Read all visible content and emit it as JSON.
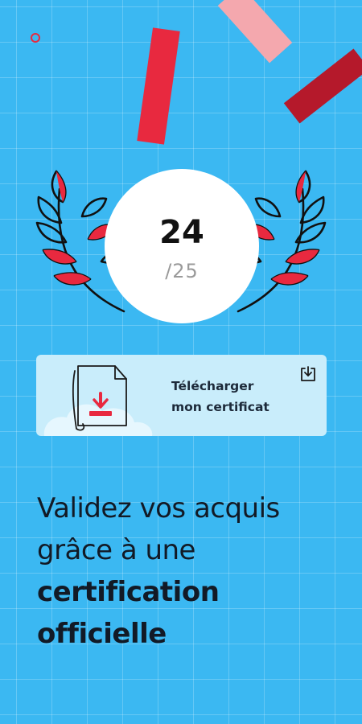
{
  "score": {
    "value": "24",
    "total": "/25"
  },
  "certificate_card": {
    "line1": "Télécharger",
    "line2": "mon certificat"
  },
  "headline": {
    "line1": "Validez vos acquis",
    "line2": "grâce à une",
    "line3": "certification",
    "line4": "officielle"
  },
  "colors": {
    "background": "#3bb8f2",
    "accent_red": "#e8293f",
    "accent_pink": "#f4a8ae",
    "accent_dark_red": "#b5192b",
    "card_background": "#c9edfb"
  },
  "icons": [
    "laurel-icon",
    "certificate-document-icon",
    "download-icon"
  ]
}
